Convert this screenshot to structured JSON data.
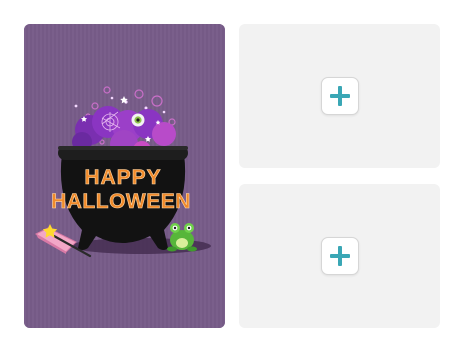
{
  "card": {
    "line1": "HAPPY",
    "line2": "HALLOWEEN",
    "background_color": "#755a86",
    "text_color": "#f08a2a"
  },
  "slots": [
    {
      "button_icon": "plus-icon",
      "accent_color": "#3aa7b5"
    },
    {
      "button_icon": "plus-icon",
      "accent_color": "#3aa7b5"
    }
  ]
}
